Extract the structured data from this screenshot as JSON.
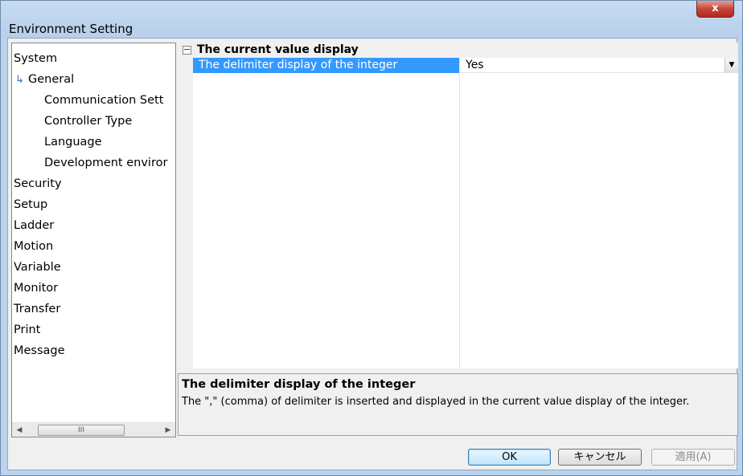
{
  "window": {
    "title": "Environment Setting",
    "close_label": "x"
  },
  "tree": {
    "items": [
      {
        "label": "System",
        "level": 1
      },
      {
        "label": "General",
        "level": 2,
        "selected": true
      },
      {
        "label": "Communication Sett",
        "level": 2
      },
      {
        "label": "Controller Type",
        "level": 2
      },
      {
        "label": "Language",
        "level": 2
      },
      {
        "label": "Development enviror",
        "level": 2
      },
      {
        "label": "Security",
        "level": 1
      },
      {
        "label": "Setup",
        "level": 1
      },
      {
        "label": "Ladder",
        "level": 1
      },
      {
        "label": "Motion",
        "level": 1
      },
      {
        "label": "Variable",
        "level": 1
      },
      {
        "label": "Monitor",
        "level": 1
      },
      {
        "label": "Transfer",
        "level": 1
      },
      {
        "label": "Print",
        "level": 1
      },
      {
        "label": "Message",
        "level": 1
      }
    ],
    "scroll_thumb_grip": "III"
  },
  "grid": {
    "category": "The current value display",
    "expander": "−",
    "property": {
      "name": "The delimiter display of the integer",
      "value": "Yes"
    }
  },
  "description": {
    "title": "The delimiter display of the integer",
    "text": "The \",\" (comma) of delimiter is inserted and displayed in the current value display of the integer."
  },
  "buttons": {
    "ok": "OK",
    "cancel": "キャンセル",
    "apply": "適用(A)"
  },
  "colors": {
    "selection": "#3399ff",
    "window_frame": "#bcd3ec"
  }
}
